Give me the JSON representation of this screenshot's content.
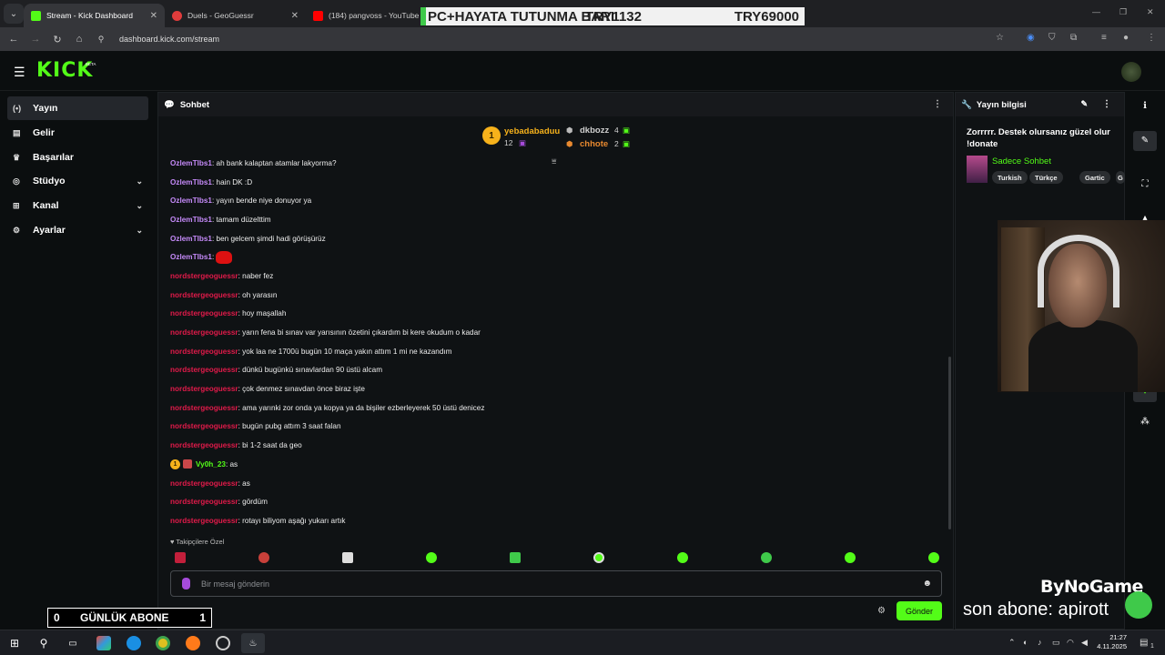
{
  "browser": {
    "tabs": [
      {
        "title": "Stream - Kick Dashboard",
        "color": "#53fc18"
      },
      {
        "title": "Duels - GeoGuessr",
        "color": "#e03c3c"
      },
      {
        "title": "(184) pangvoss - YouTube",
        "color": "#ff0000"
      }
    ],
    "overlay_bar": {
      "left": "PC+HAYATA TUTUNMA BARI",
      "middle": "TRY1132",
      "right": "TRY69000"
    },
    "url": "dashboard.kick.com/stream"
  },
  "header": {
    "logo": "KICK",
    "beta": "BETA"
  },
  "sidebar": {
    "items": [
      {
        "label": "Yayın",
        "icon": "(•)"
      },
      {
        "label": "Gelir",
        "icon": "▤"
      },
      {
        "label": "Başarılar",
        "icon": "♛"
      },
      {
        "label": "Stüdyo",
        "icon": "◎"
      },
      {
        "label": "Kanal",
        "icon": "⊞"
      },
      {
        "label": "Ayarlar",
        "icon": "⚙"
      }
    ]
  },
  "chat": {
    "title": "Sohbet",
    "gifters": {
      "top": {
        "rank": "1",
        "name": "yebadabaduu",
        "count": "12"
      },
      "second": {
        "name": "dkbozz",
        "count": "4"
      },
      "third": {
        "name": "chhote",
        "count": "2"
      }
    },
    "messages": [
      {
        "user": "OzlemTlbs1",
        "text": ": ah bank kalaptan atamlar lakyorma?",
        "color": "purple"
      },
      {
        "user": "OzlemTlbs1",
        "text": ": hain DK :D",
        "color": "purple"
      },
      {
        "user": "OzlemTlbs1",
        "text": ": yayın bende niye donuyor ya",
        "color": "purple"
      },
      {
        "user": "OzlemTlbs1",
        "text": ": tamam düzelttim",
        "color": "purple"
      },
      {
        "user": "OzlemTlbs1",
        "text": ": ben gelcem şimdi hadi görüşürüz",
        "color": "purple"
      },
      {
        "user": "OzlemTlbs1",
        "text": ": ",
        "color": "purple",
        "emote": true
      },
      {
        "user": "nordstergeoguessr",
        "text": ": naber fez",
        "color": "red"
      },
      {
        "user": "nordstergeoguessr",
        "text": ": oh yarasın",
        "color": "red"
      },
      {
        "user": "nordstergeoguessr",
        "text": ": hoy maşallah",
        "color": "red"
      },
      {
        "user": "nordstergeoguessr",
        "text": ": yarın fena bi sınav var yarısının özetini çıkardım bi kere okudum o kadar",
        "color": "red"
      },
      {
        "user": "nordstergeoguessr",
        "text": ": yok laa ne 1700ü bugün 10 maça yakın attım 1 mi ne kazandım",
        "color": "red"
      },
      {
        "user": "nordstergeoguessr",
        "text": ": dünkü bugünkü sınavlardan 90 üstü alcam",
        "color": "red"
      },
      {
        "user": "nordstergeoguessr",
        "text": ": çok denmez sınavdan önce biraz işte",
        "color": "red"
      },
      {
        "user": "nordstergeoguessr",
        "text": ": ama yarınki zor onda ya kopya ya da bişiler ezberleyerek 50 üstü denicez",
        "color": "red"
      },
      {
        "user": "nordstergeoguessr",
        "text": ": bugün pubg attım 3 saat falan",
        "color": "red"
      },
      {
        "user": "nordstergeoguessr",
        "text": ": bi 1-2 saat da geo",
        "color": "red"
      },
      {
        "user": "Vy0h_23",
        "text": ": as",
        "color": "green",
        "badges": true
      },
      {
        "user": "nordstergeoguessr",
        "text": ": as",
        "color": "red"
      },
      {
        "user": "nordstergeoguessr",
        "text": ": gördüm",
        "color": "red"
      },
      {
        "user": "nordstergeoguessr",
        "text": ": rotayı biliyom aşağı yukarı artık",
        "color": "red"
      }
    ],
    "followers_label": "Takipçilere Özel",
    "input_placeholder": "Bir mesaj gönderin",
    "send_label": "Gönder"
  },
  "info": {
    "title": "Yayın bilgisi",
    "stream_title": "Zorrrrr. Destek olursanız güzel olur !donate",
    "category": "Sadece Sohbet",
    "tags": [
      "Turkish",
      "Türkçe",
      "Gartic",
      "G"
    ]
  },
  "overlays": {
    "daily_sub": {
      "left": "0",
      "label": "GÜNLÜK ABONE",
      "right": "1"
    },
    "brand": "ByNoGame",
    "last_sub": "son abone: apirott"
  },
  "taskbar": {
    "time": "21:27",
    "date": "4.11.2025",
    "notif": "1"
  }
}
